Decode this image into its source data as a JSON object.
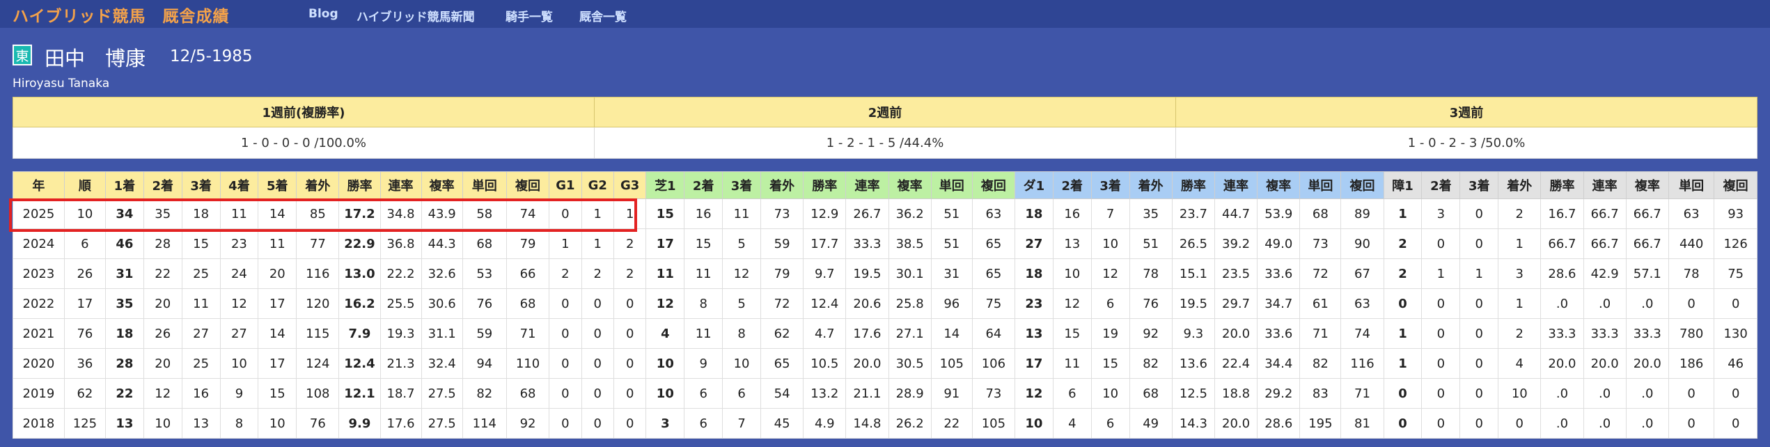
{
  "nav": {
    "site_title": "ハイブリッド競馬　厩舎成績",
    "links": [
      "Blog",
      "ハイブリッド競馬新聞",
      "騎手一覧",
      "厩舎一覧"
    ]
  },
  "jockey": {
    "badge": "東",
    "name": "田中　博康",
    "birth": "12/5-1985",
    "roman": "Hiroyasu Tanaka"
  },
  "weeks": {
    "headers": [
      "1週前(複勝率)",
      "2週前",
      "3週前"
    ],
    "values": [
      "1 - 0 - 0 - 0 /100.0%",
      "1 - 2 - 1 - 5 /44.4%",
      "1 - 0 - 2 - 3 /50.0%"
    ]
  },
  "stats": {
    "headers": [
      "年",
      "順",
      "1着",
      "2着",
      "3着",
      "4着",
      "5着",
      "着外",
      "勝率",
      "連率",
      "複率",
      "単回",
      "複回",
      "G1",
      "G2",
      "G3",
      "芝1",
      "2着",
      "3着",
      "着外",
      "勝率",
      "連率",
      "複率",
      "単回",
      "複回",
      "ダ1",
      "2着",
      "3着",
      "着外",
      "勝率",
      "連率",
      "複率",
      "単回",
      "複回",
      "障1",
      "2着",
      "3着",
      "着外",
      "勝率",
      "連率",
      "複率",
      "単回",
      "複回"
    ],
    "rows": [
      [
        "2025",
        "10",
        "34",
        "35",
        "18",
        "11",
        "14",
        "85",
        "17.2",
        "34.8",
        "43.9",
        "58",
        "74",
        "0",
        "1",
        "1",
        "15",
        "16",
        "11",
        "73",
        "12.9",
        "26.7",
        "36.2",
        "51",
        "63",
        "18",
        "16",
        "7",
        "35",
        "23.7",
        "44.7",
        "53.9",
        "68",
        "89",
        "1",
        "3",
        "0",
        "2",
        "16.7",
        "66.7",
        "66.7",
        "63",
        "93"
      ],
      [
        "2024",
        "6",
        "46",
        "28",
        "15",
        "23",
        "11",
        "77",
        "22.9",
        "36.8",
        "44.3",
        "68",
        "79",
        "1",
        "1",
        "2",
        "17",
        "15",
        "5",
        "59",
        "17.7",
        "33.3",
        "38.5",
        "51",
        "65",
        "27",
        "13",
        "10",
        "51",
        "26.5",
        "39.2",
        "49.0",
        "73",
        "90",
        "2",
        "0",
        "0",
        "1",
        "66.7",
        "66.7",
        "66.7",
        "440",
        "126"
      ],
      [
        "2023",
        "26",
        "31",
        "22",
        "25",
        "24",
        "20",
        "116",
        "13.0",
        "22.2",
        "32.6",
        "53",
        "66",
        "2",
        "2",
        "2",
        "11",
        "11",
        "12",
        "79",
        "9.7",
        "19.5",
        "30.1",
        "31",
        "65",
        "18",
        "10",
        "12",
        "78",
        "15.1",
        "23.5",
        "33.6",
        "72",
        "67",
        "2",
        "1",
        "1",
        "3",
        "28.6",
        "42.9",
        "57.1",
        "78",
        "75"
      ],
      [
        "2022",
        "17",
        "35",
        "20",
        "11",
        "12",
        "17",
        "120",
        "16.2",
        "25.5",
        "30.6",
        "76",
        "68",
        "0",
        "0",
        "0",
        "12",
        "8",
        "5",
        "72",
        "12.4",
        "20.6",
        "25.8",
        "96",
        "75",
        "23",
        "12",
        "6",
        "76",
        "19.5",
        "29.7",
        "34.7",
        "61",
        "63",
        "0",
        "0",
        "0",
        "1",
        ".0",
        ".0",
        ".0",
        "0",
        "0"
      ],
      [
        "2021",
        "76",
        "18",
        "26",
        "27",
        "27",
        "14",
        "115",
        "7.9",
        "19.3",
        "31.1",
        "59",
        "71",
        "0",
        "0",
        "0",
        "4",
        "11",
        "8",
        "62",
        "4.7",
        "17.6",
        "27.1",
        "14",
        "64",
        "13",
        "15",
        "19",
        "92",
        "9.3",
        "20.0",
        "33.6",
        "71",
        "74",
        "1",
        "0",
        "0",
        "2",
        "33.3",
        "33.3",
        "33.3",
        "780",
        "130"
      ],
      [
        "2020",
        "36",
        "28",
        "20",
        "25",
        "10",
        "17",
        "124",
        "12.4",
        "21.3",
        "32.4",
        "94",
        "110",
        "0",
        "0",
        "0",
        "10",
        "9",
        "10",
        "65",
        "10.5",
        "20.0",
        "30.5",
        "105",
        "106",
        "17",
        "11",
        "15",
        "82",
        "13.6",
        "22.4",
        "34.4",
        "82",
        "116",
        "1",
        "0",
        "0",
        "4",
        "20.0",
        "20.0",
        "20.0",
        "186",
        "46"
      ],
      [
        "2019",
        "62",
        "22",
        "12",
        "16",
        "9",
        "15",
        "108",
        "12.1",
        "18.7",
        "27.5",
        "82",
        "68",
        "0",
        "0",
        "0",
        "10",
        "6",
        "6",
        "54",
        "13.2",
        "21.1",
        "28.9",
        "91",
        "73",
        "12",
        "6",
        "10",
        "68",
        "12.5",
        "18.8",
        "29.2",
        "83",
        "71",
        "0",
        "0",
        "0",
        "10",
        ".0",
        ".0",
        ".0",
        "0",
        "0"
      ],
      [
        "2018",
        "125",
        "13",
        "10",
        "13",
        "8",
        "10",
        "76",
        "9.9",
        "17.6",
        "27.5",
        "114",
        "92",
        "0",
        "0",
        "0",
        "3",
        "6",
        "7",
        "45",
        "4.9",
        "14.8",
        "26.2",
        "22",
        "105",
        "10",
        "4",
        "6",
        "49",
        "14.3",
        "20.0",
        "28.6",
        "195",
        "81",
        "0",
        "0",
        "0",
        "0",
        ".0",
        ".0",
        ".0",
        "0",
        "0"
      ]
    ]
  },
  "colors": {
    "background": "#3f55a8",
    "nav_bar": "#2f4594",
    "title_orange": "#f4a24a",
    "header_yellow": "#fcec9e",
    "header_green": "#bdf0a3",
    "header_blue": "#a9cdf4",
    "header_gray": "#e2e2e2",
    "highlight_red": "#e32222"
  }
}
